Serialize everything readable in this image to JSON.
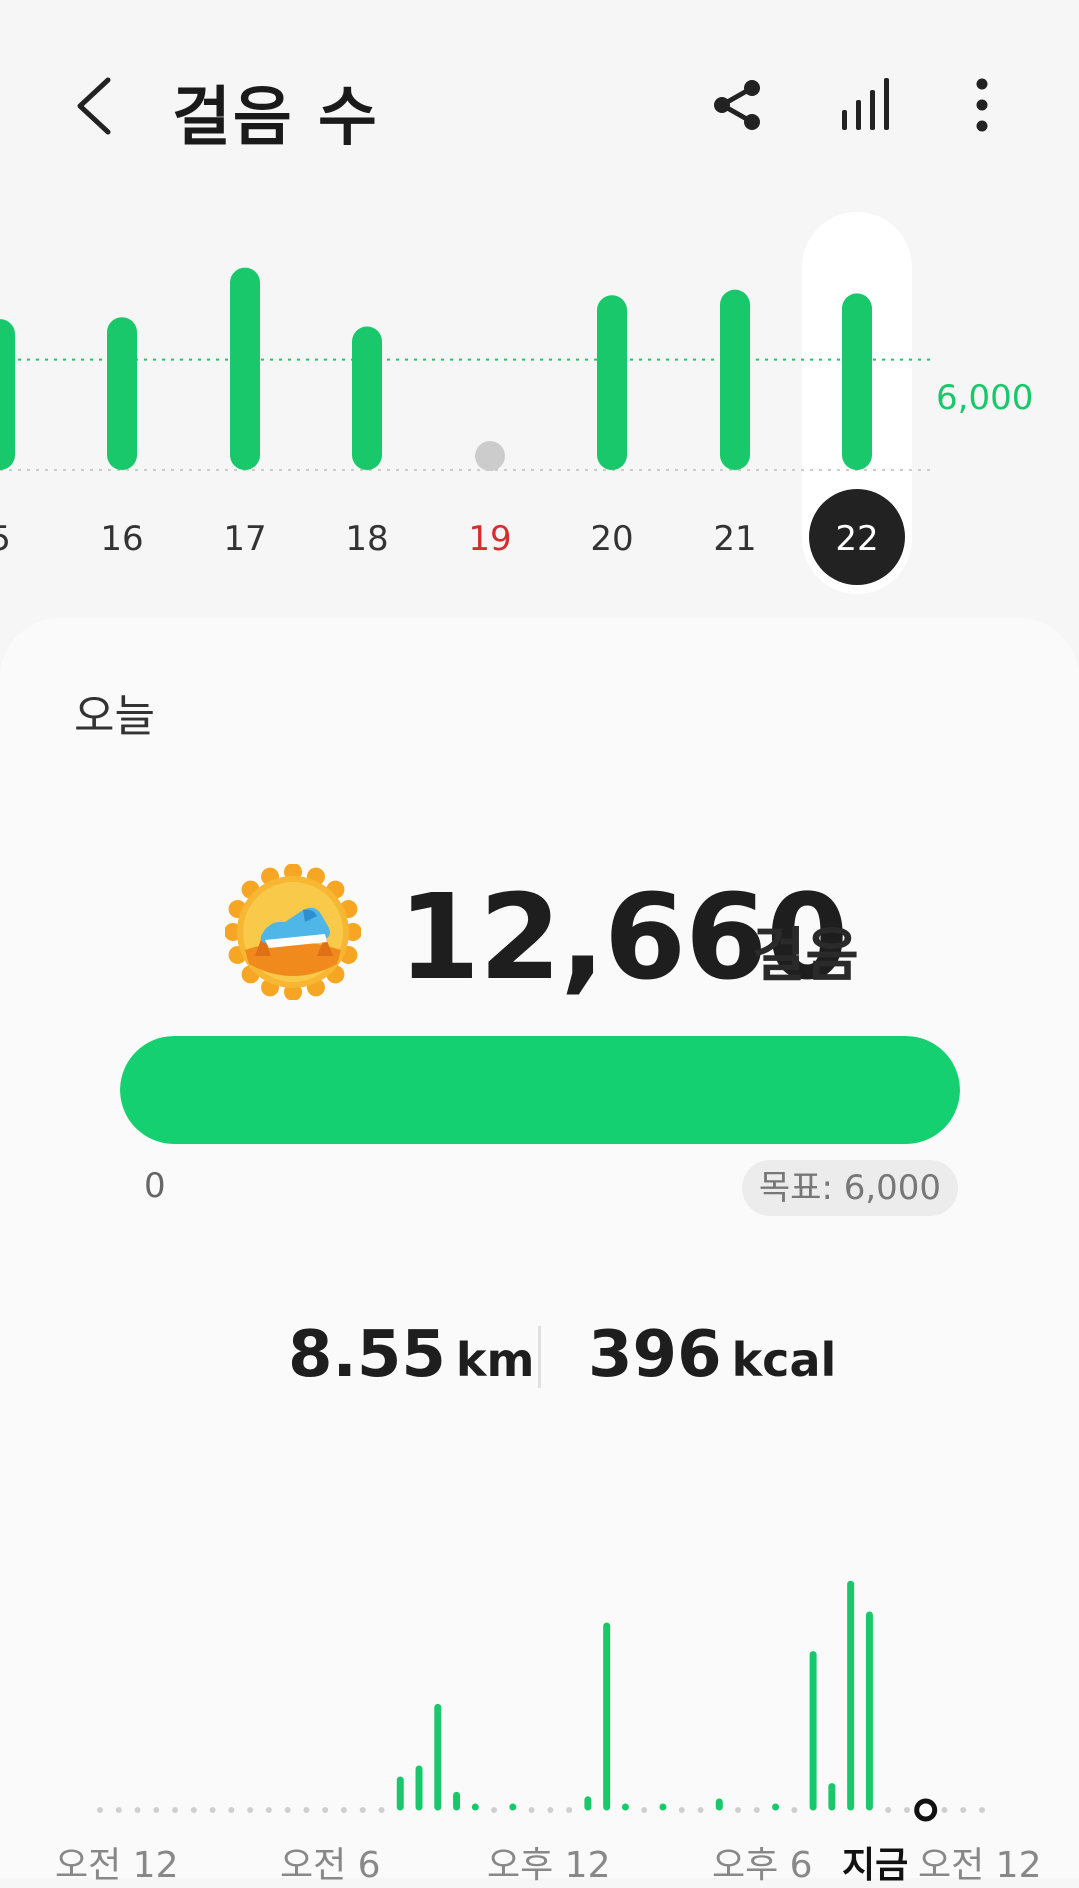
{
  "header": {
    "title": "걸음 수",
    "icons": [
      "back-arrow-icon",
      "share-icon",
      "chart-bars-icon",
      "more-vert-icon"
    ]
  },
  "weekly": {
    "goal_label": "6,000",
    "goal_value": 6000,
    "selected_day": "22",
    "days": [
      {
        "label": "5",
        "steps": 8200,
        "color": "#333333"
      },
      {
        "label": "16",
        "steps": 8300,
        "color": "#333333"
      },
      {
        "label": "17",
        "steps": 11000,
        "color": "#333333"
      },
      {
        "label": "18",
        "steps": 7800,
        "color": "#333333"
      },
      {
        "label": "19",
        "steps": 0,
        "color": "#d32f2f"
      },
      {
        "label": "20",
        "steps": 9500,
        "color": "#333333"
      },
      {
        "label": "21",
        "steps": 9800,
        "color": "#333333"
      },
      {
        "label": "22",
        "steps": 9600,
        "color": "#ffffff"
      }
    ],
    "colors": {
      "bar": "#19c86a",
      "zero_dot": "#cccccc",
      "selected_bg": "#222222"
    }
  },
  "today": {
    "label": "오늘",
    "steps": "12,660",
    "unit": "걸음",
    "badge_icon": "running-shoe-badge-icon",
    "progress_fraction": 1.0,
    "progress_min": "0",
    "goal_text": "목표: 6,000"
  },
  "stats": {
    "distance": {
      "value": "8.55",
      "unit": "km"
    },
    "calories": {
      "value": "396",
      "unit": "kcal"
    }
  },
  "hourly": {
    "axis_labels": [
      "오전 12",
      "오전 6",
      "오후 12",
      "오후 6",
      "지금",
      "오전 12"
    ],
    "values": [
      0,
      0,
      0,
      0,
      0,
      0,
      0,
      0,
      0,
      0,
      0,
      0,
      0,
      0,
      0,
      0,
      15,
      20,
      48,
      8,
      2,
      0,
      2,
      0,
      0,
      0,
      6,
      85,
      2,
      0,
      2,
      0,
      0,
      5,
      0,
      0,
      2,
      0,
      72,
      12,
      104,
      90,
      0,
      0,
      0,
      0,
      0,
      0
    ],
    "now_index": 44,
    "colors": {
      "bar": "#19c86a",
      "dot": "#cfcfcf"
    }
  }
}
